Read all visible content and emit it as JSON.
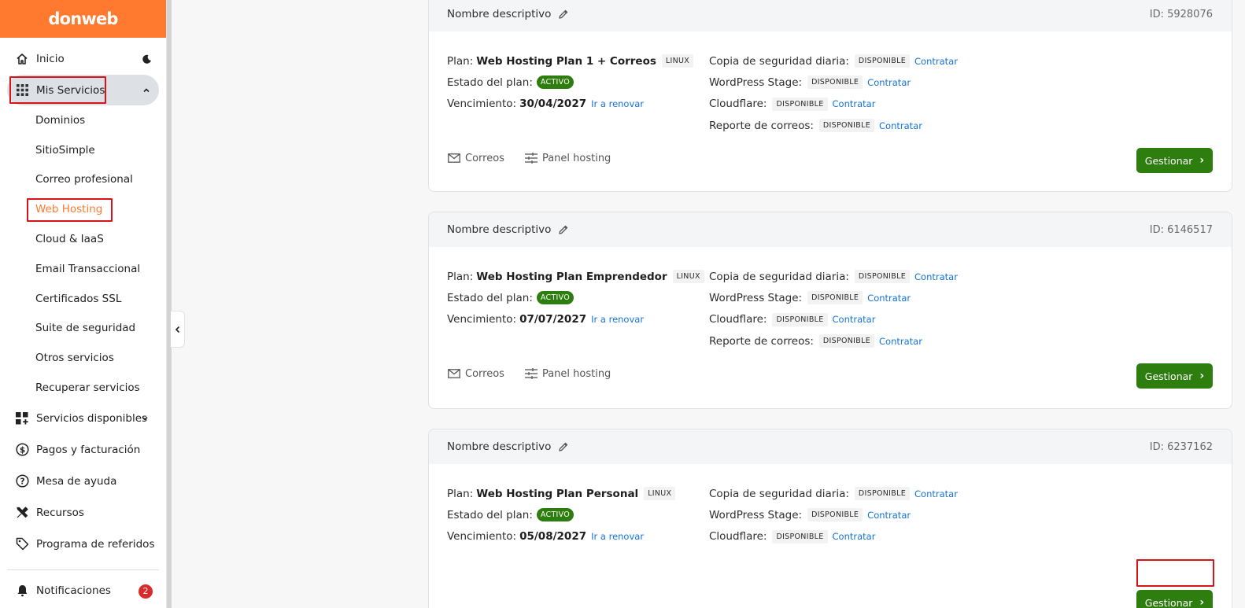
{
  "logo": "donweb",
  "nav": {
    "inicio": "Inicio",
    "mis_servicios": "Mis Servicios",
    "sub_items": [
      "Dominios",
      "SitioSimple",
      "Correo profesional",
      "Web Hosting",
      "Cloud & IaaS",
      "Email Transaccional",
      "Certificados SSL",
      "Suite de seguridad",
      "Otros servicios",
      "Recuperar servicios"
    ],
    "servicios_disponibles": "Servicios disponibles",
    "pagos": "Pagos y facturación",
    "mesa_ayuda": "Mesa de ayuda",
    "recursos": "Recursos",
    "referidos": "Programa de referidos",
    "notificaciones": "Notificaciones",
    "notif_count": "2"
  },
  "labels": {
    "nombre": "Nombre descriptivo",
    "plan": "Plan:",
    "estado": "Estado del plan:",
    "vencimiento": "Vencimiento:",
    "renovar": "Ir a renovar",
    "copia": "Copia de seguridad diaria:",
    "wpstage": "WordPress Stage:",
    "cloudflare": "Cloudflare:",
    "reporte": "Reporte de correos:",
    "disponible": "DISPONIBLE",
    "contratar": "Contratar",
    "activo": "ACTIVO",
    "linux": "LINUX",
    "correos": "Correos",
    "panel": "Panel hosting",
    "gestionar": "Gestionar"
  },
  "cards": [
    {
      "id": "ID: 5928076",
      "plan": "Web Hosting Plan 1 + Correos",
      "vence": "30/04/2027"
    },
    {
      "id": "ID: 6146517",
      "plan": "Web Hosting Plan Emprendedor",
      "vence": "07/07/2027"
    },
    {
      "id": "ID: 6237162",
      "plan": "Web Hosting Plan Personal",
      "vence": "05/08/2027"
    }
  ],
  "colors": {
    "brand": "#ff7a2e",
    "green": "#2e7d0f",
    "link": "#1473d8",
    "highlight": "#d8141a"
  }
}
